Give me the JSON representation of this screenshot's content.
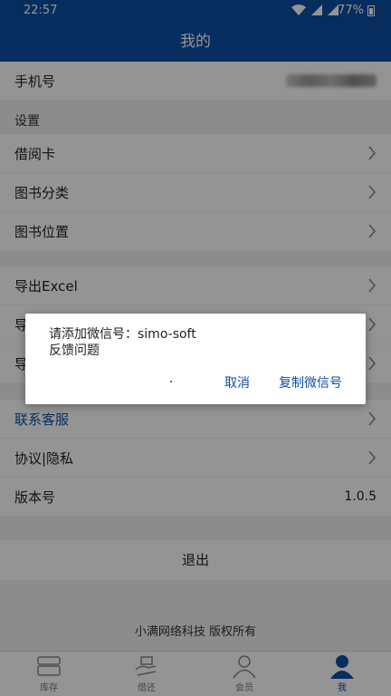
{
  "status": {
    "time": "22:57",
    "battery": "77%"
  },
  "header": {
    "title": "我的"
  },
  "phone": {
    "label": "手机号"
  },
  "settings": {
    "title": "设置",
    "items": [
      {
        "label": "借阅卡"
      },
      {
        "label": "图书分类"
      },
      {
        "label": "图书位置"
      }
    ]
  },
  "export": {
    "items": [
      {
        "label": "导出Excel"
      },
      {
        "label": "导"
      },
      {
        "label": "导"
      }
    ]
  },
  "support": {
    "items": [
      {
        "label": "联系客服"
      },
      {
        "label": "协议|隐私"
      }
    ],
    "version_label": "版本号",
    "version_value": "1.0.5"
  },
  "logout": {
    "label": "退出"
  },
  "footer": {
    "copyright": "小满网络科技 版权所有"
  },
  "tabs": [
    {
      "label": "库存",
      "icon": "inventory-icon"
    },
    {
      "label": "借还",
      "icon": "borrow-return-icon"
    },
    {
      "label": "会员",
      "icon": "member-icon"
    },
    {
      "label": "我",
      "icon": "me-icon",
      "active": true
    }
  ],
  "dialog": {
    "line1": "请添加微信号：simo-soft",
    "line2": "反馈问题",
    "cancel": "取消",
    "copy": "复制微信号"
  },
  "colors": {
    "primary": "#0d4fa3",
    "background": "#f2f2f2"
  }
}
